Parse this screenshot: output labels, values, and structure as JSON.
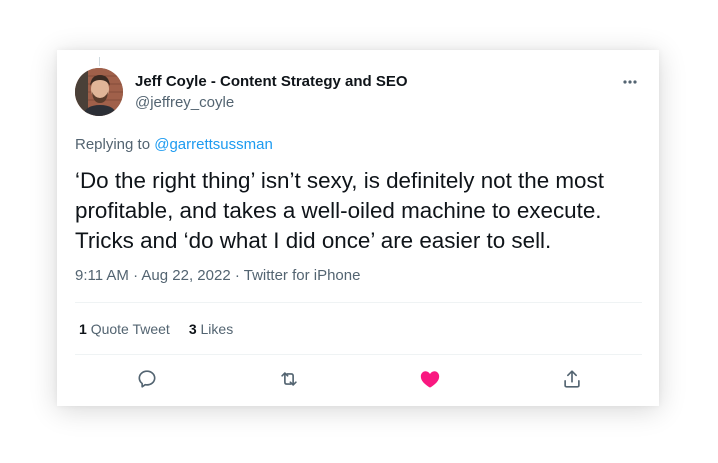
{
  "author": {
    "name": "Jeff Coyle - Content Strategy and SEO",
    "handle": "@jeffrey_coyle"
  },
  "reply": {
    "prefix": "Replying to",
    "mention": "@garrettsussman"
  },
  "tweet": {
    "lines": [
      "‘Do the right thing’ isn’t sexy, is definitely not the most",
      "profitable, and takes a well-oiled machine to execute.",
      "Tricks and ‘do what I did once’ are easier to sell."
    ],
    "timestamp": "9:11 AM · Aug 22, 2022 · Twitter for iPhone"
  },
  "stats": {
    "quote_count": "1",
    "quote_label": "Quote Tweet",
    "like_count": "3",
    "like_label": "Likes"
  },
  "actions": {
    "reply_icon": "reply-icon",
    "retweet_icon": "retweet-icon",
    "like_icon": "heart-filled-icon",
    "share_icon": "share-icon"
  },
  "colors": {
    "link": "#1d9bf0",
    "secondary_text": "#536471",
    "like": "#f91880",
    "icon": "#536471"
  }
}
